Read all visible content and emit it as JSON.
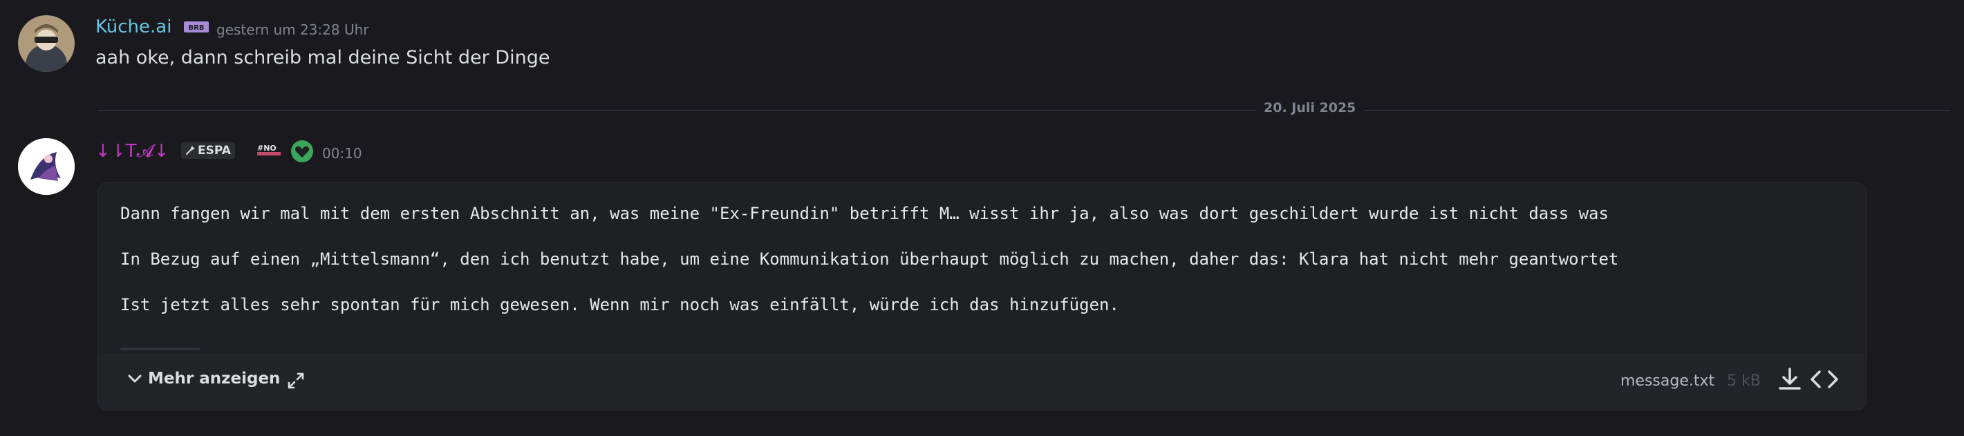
{
  "messages": [
    {
      "author": "Küche.ai",
      "author_color": "#67c5e3",
      "badge_text": "BRB",
      "badge_color": "#a58bd6",
      "timestamp": "gestern um 23:28 Uhr",
      "text": "aah oke, dann schreib mal deine Sicht der Dinge"
    },
    {
      "author": "↓⇂T𝓐↓",
      "author_color": "#c236c4",
      "tag_label": "ESPA",
      "tag_icon": "wrench-icon",
      "badge_text": "#NO",
      "role_icon": "heart-hands-icon",
      "role_icon_color": "#3ba55c",
      "timestamp": "00:10"
    }
  ],
  "date_divider": "20. Juli 2025",
  "attachment": {
    "lines": [
      "Dann fangen wir mal mit dem ersten Abschnitt an, was meine \"Ex-Freundin\" betrifft M… wisst ihr ja, also was dort geschildert wurde ist nicht dass was",
      "In Bezug auf einen „Mittelsmann“, den ich benutzt habe, um eine Kommunikation überhaupt möglich zu machen, daher das: Klara hat nicht mehr geantwortet",
      "Ist jetzt alles sehr spontan für mich gewesen. Wenn mir noch was einfällt, würde ich das hinzufügen."
    ],
    "show_more_label": "Mehr anzeigen",
    "file_name": "message.txt",
    "file_size": "5 kB",
    "icons": [
      "chevron-down-icon",
      "expand-icon",
      "download-icon",
      "code-icon"
    ]
  }
}
